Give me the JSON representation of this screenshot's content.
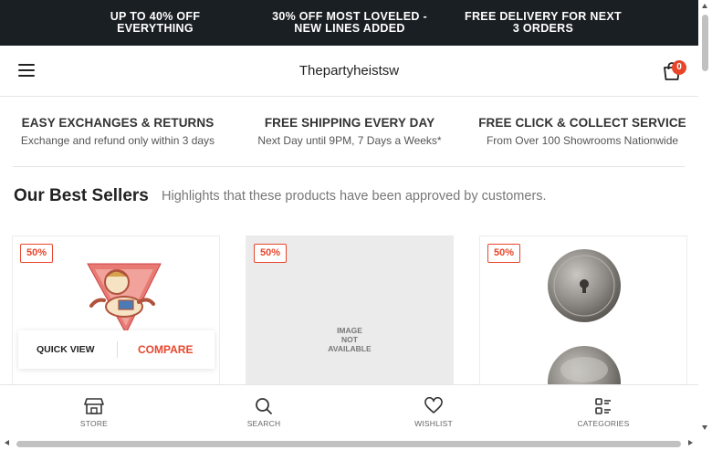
{
  "promo_bar": {
    "items": [
      "UP TO 40% OFF EVERYTHING",
      "30% OFF MOST LOVELED - NEW LINES ADDED",
      "FREE DELIVERY FOR NEXT 3 ORDERS"
    ],
    "lines": [
      [
        "UP TO 40% OFF",
        "EVERYTHING"
      ],
      [
        "30% OFF MOST LOVELED -",
        "NEW LINES ADDED"
      ],
      [
        "FREE DELIVERY FOR NEXT",
        "3 ORDERS"
      ]
    ]
  },
  "header": {
    "brand": "Thepartyheistsw",
    "cart_count": "0",
    "icons": [
      "menu-icon",
      "shopping-bag-icon"
    ]
  },
  "features": [
    {
      "title": "EASY EXCHANGES & RETURNS",
      "subtitle": "Exchange and refund only within 3 days"
    },
    {
      "title": "FREE SHIPPING EVERY DAY",
      "subtitle": "Next Day until 9PM, 7 Days a Weeks*"
    },
    {
      "title": "FREE CLICK & COLLECT SERVICE",
      "subtitle": "From Over 100 Showrooms Nationwide"
    }
  ],
  "best_sellers": {
    "title": "Our Best Sellers",
    "subtitle": "Highlights that these products have been approved by customers."
  },
  "products": [
    {
      "badge": "50%",
      "quick_view": "QUICK VIEW",
      "compare": "COMPARE"
    },
    {
      "badge": "50%",
      "image_text": [
        "IMAGE",
        "NOT",
        "AVAILABLE"
      ]
    },
    {
      "badge": "50%"
    }
  ],
  "bottom_nav": [
    {
      "label": "STORE",
      "icon": "store-icon"
    },
    {
      "label": "SEARCH",
      "icon": "search-icon"
    },
    {
      "label": "WISHLIST",
      "icon": "heart-icon"
    },
    {
      "label": "CATEGORIES",
      "icon": "categories-icon"
    }
  ],
  "colors": {
    "promo_bg": "#1a1f24",
    "accent": "#e8462b",
    "card_placeholder": "#ebebeb"
  }
}
